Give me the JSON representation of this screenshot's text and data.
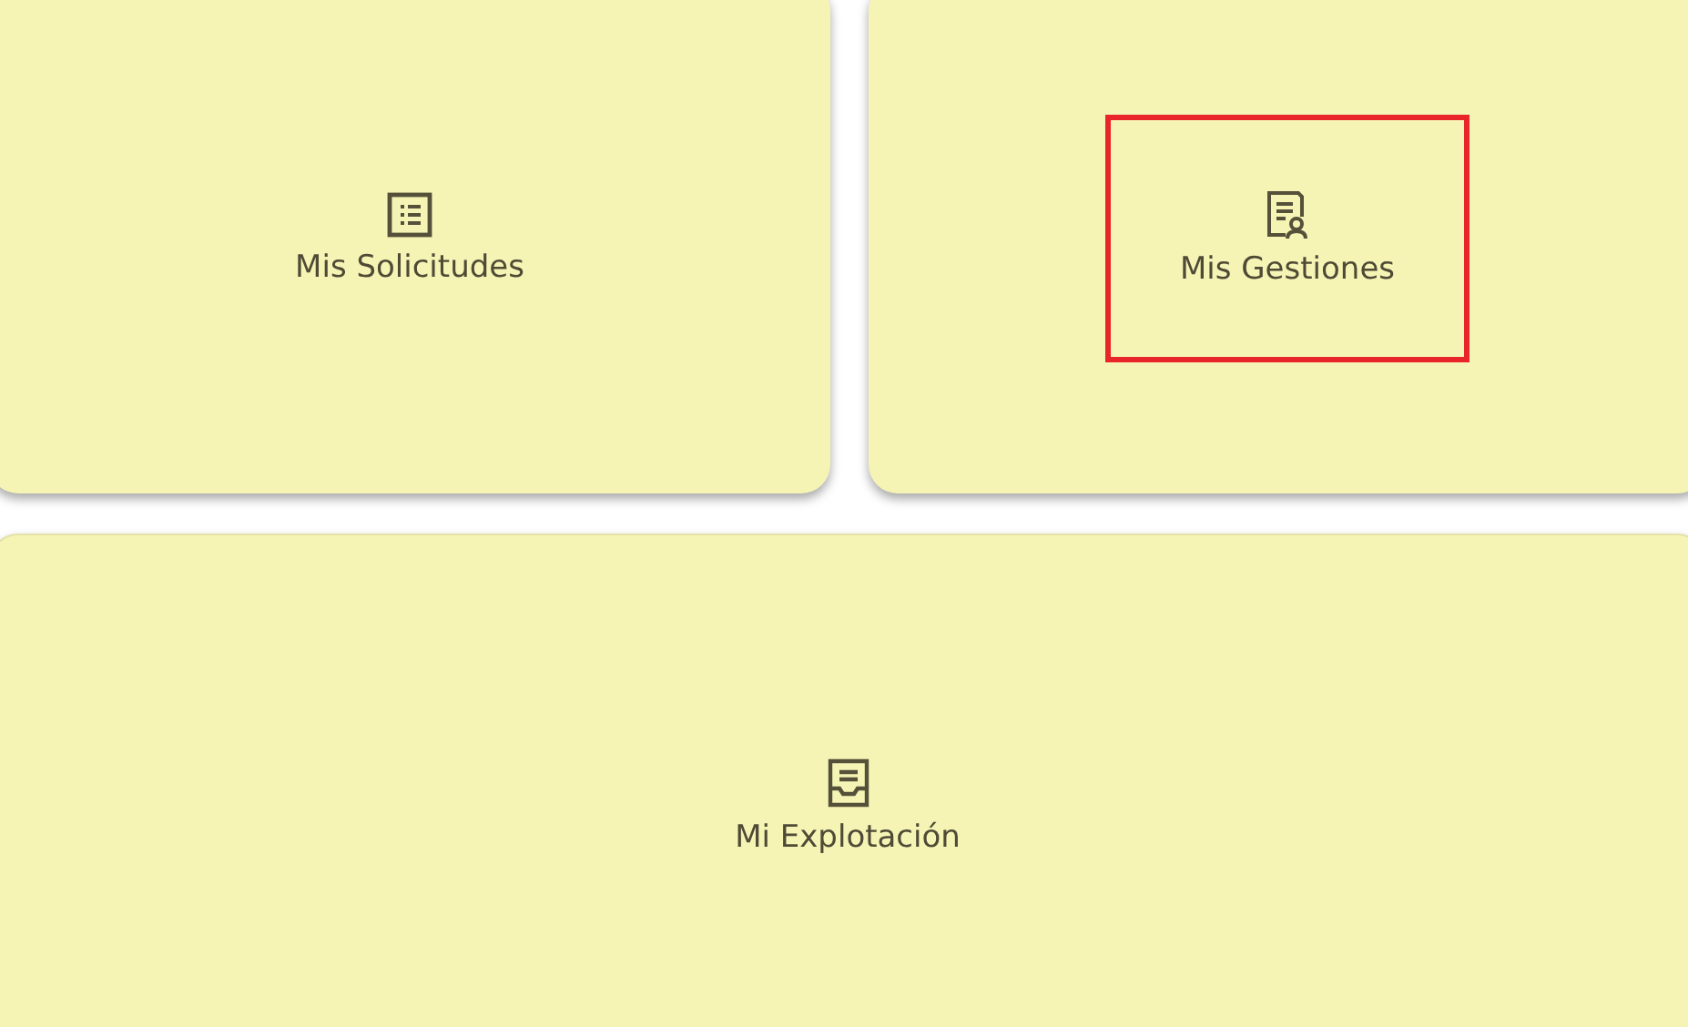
{
  "cards": [
    {
      "label": "Mis Solicitudes",
      "kind": "list",
      "highlighted": false
    },
    {
      "label": "Mis Gestiones",
      "kind": "certificate",
      "highlighted": true
    },
    {
      "label": "Mi Explotación",
      "kind": "tray",
      "highlighted": false
    }
  ]
}
